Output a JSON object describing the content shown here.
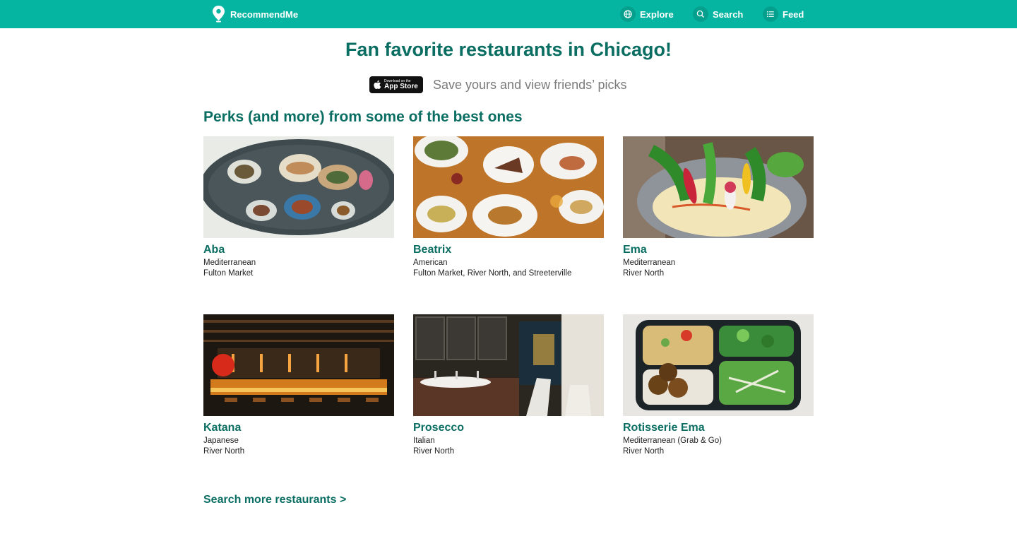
{
  "header": {
    "brand": "RecommendMe",
    "nav": [
      {
        "label": "Explore",
        "icon": "globe-icon"
      },
      {
        "label": "Search",
        "icon": "search-icon"
      },
      {
        "label": "Feed",
        "icon": "list-icon"
      }
    ]
  },
  "hero": {
    "title": "Fan favorite restaurants in Chicago!",
    "appstore_small": "Download on the",
    "appstore_big": "App Store",
    "subtitle": "Save yours and view friends’ picks"
  },
  "section_title": "Perks (and more) from some of the best ones",
  "restaurants": [
    {
      "name": "Aba",
      "cuisine": "Mediterranean",
      "neighborhood": "Fulton Market"
    },
    {
      "name": "Beatrix",
      "cuisine": "American",
      "neighborhood": "Fulton Market, River North, and Streeterville"
    },
    {
      "name": "Ema",
      "cuisine": "Mediterranean",
      "neighborhood": "River North"
    },
    {
      "name": "Katana",
      "cuisine": "Japanese",
      "neighborhood": "River North"
    },
    {
      "name": "Prosecco",
      "cuisine": "Italian",
      "neighborhood": "River North"
    },
    {
      "name": "Rotisserie Ema",
      "cuisine": "Mediterranean (Grab & Go)",
      "neighborhood": "River North"
    }
  ],
  "more_link": "Search more restaurants >",
  "colors": {
    "brand": "#06b5a1",
    "heading": "#0b6e62"
  }
}
